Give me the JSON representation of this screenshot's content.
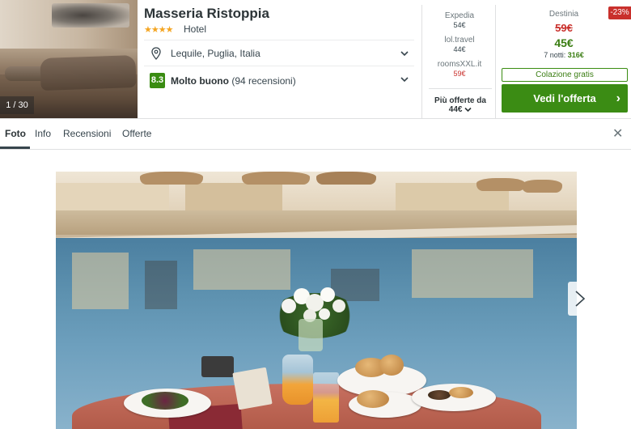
{
  "gallery": {
    "counter": "1 / 30"
  },
  "hotel": {
    "name": "Masseria Ristoppia",
    "stars": "★★★★",
    "type": "Hotel",
    "location": "Lequile, Puglia, Italia",
    "rating_score": "8.3",
    "rating_label": "Molto buono",
    "rating_count": "(94 recensioni)"
  },
  "offers": [
    {
      "site": "Expedia",
      "price": "54€",
      "color": "#37454d"
    },
    {
      "site": "lol.travel",
      "price": "44€",
      "color": "#37454d"
    },
    {
      "site": "roomsXXL.it",
      "price": "59€",
      "color": "#c9302c"
    }
  ],
  "more_offers": {
    "line1": "Più offerte da",
    "line2": "44€"
  },
  "deal": {
    "badge": "-23%",
    "site": "Destinia",
    "old_price": "59€",
    "new_price": "45€",
    "nights_label": "7 notti:",
    "nights_total": "316€",
    "breakfast": "Colazione gratis",
    "cta": "Vedi l'offerta",
    "cta_color": "#3b8c14"
  },
  "tabs": [
    {
      "label": "Foto",
      "active": true
    },
    {
      "label": "Info",
      "active": false
    },
    {
      "label": "Recensioni",
      "active": false
    },
    {
      "label": "Offerte",
      "active": false
    }
  ],
  "close_icon": "close-icon",
  "photo": {
    "next_icon": "chevron-right-icon"
  }
}
